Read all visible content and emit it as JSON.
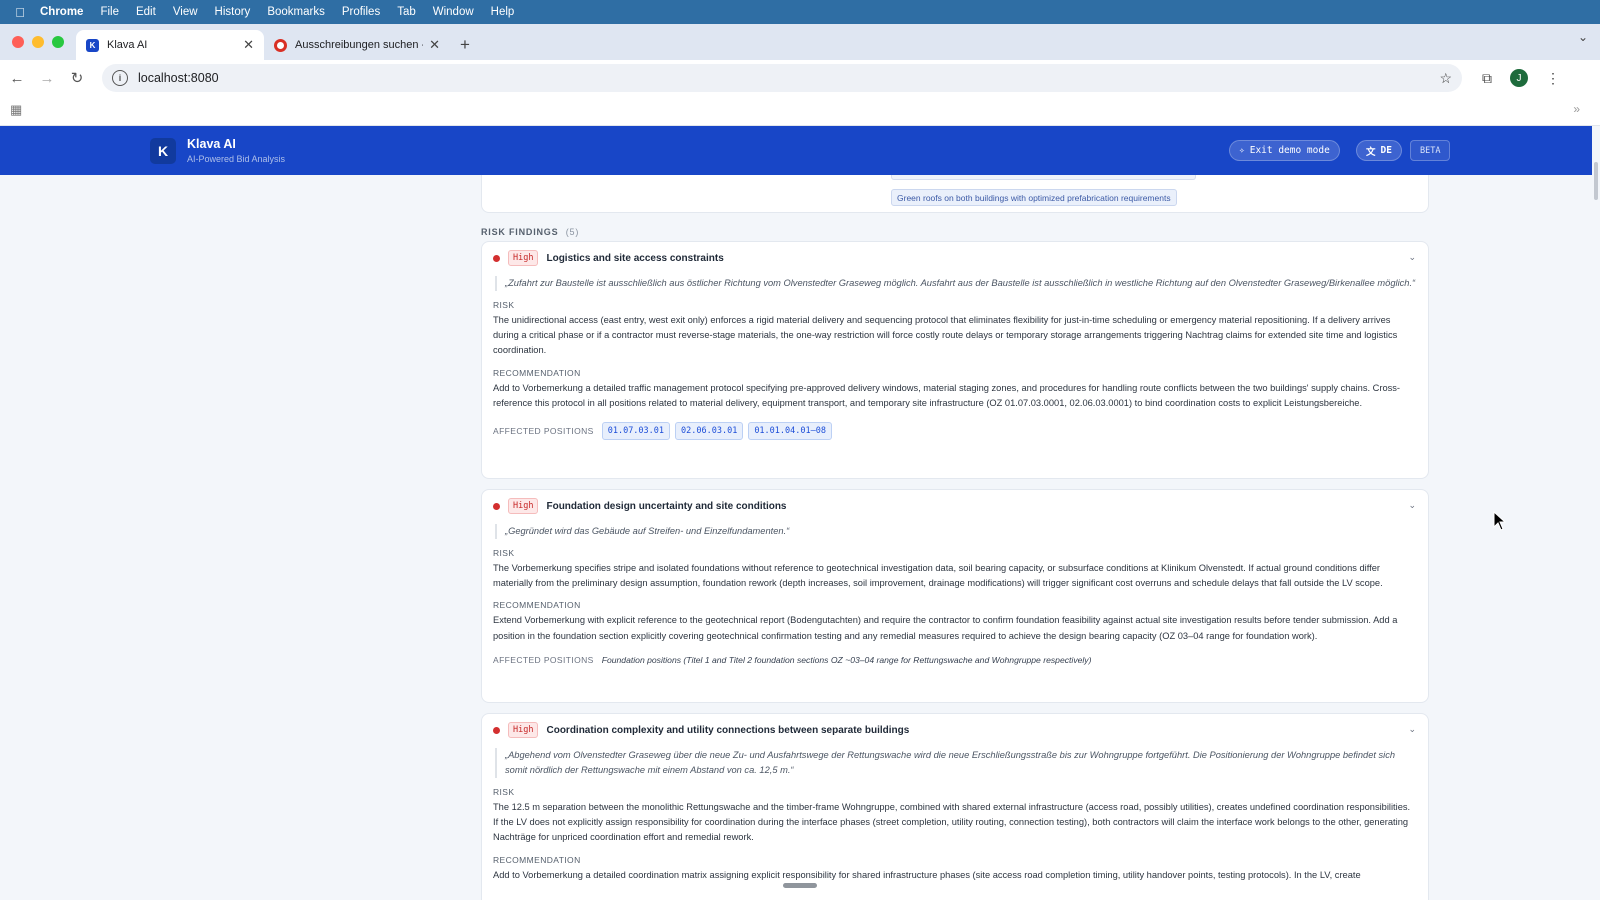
{
  "menubar": {
    "app": "Chrome",
    "items": [
      "File",
      "Edit",
      "View",
      "History",
      "Bookmarks",
      "Profiles",
      "Tab",
      "Window",
      "Help"
    ]
  },
  "tabs": [
    {
      "title": "Klava AI",
      "favicon": "K"
    },
    {
      "title": "Ausschreibungen suchen - e"
    }
  ],
  "address": {
    "url": "localhost:8080"
  },
  "app": {
    "logo": "K",
    "title": "Klava AI",
    "subtitle": "AI-Powered Bid Analysis",
    "exit_demo": "Exit demo mode",
    "lang": "DE",
    "beta": "BETA"
  },
  "top_card": {
    "strength_tag": "Green roofs on both buildings with optimized prefabrication requirements"
  },
  "risk_section": {
    "title": "RISK FINDINGS",
    "count": "(5)"
  },
  "labels": {
    "risk": "RISK",
    "recommendation": "RECOMMENDATION",
    "affected": "AFFECTED POSITIONS"
  },
  "findings": [
    {
      "severity": "High",
      "title": "Logistics and site access constraints",
      "quote": "„Zufahrt zur Baustelle ist ausschließlich aus östlicher Richtung vom Olvenstedter Graseweg möglich. Ausfahrt aus der Baustelle ist ausschließlich in westliche Richtung auf den Olvenstedter Graseweg/Birkenallee möglich.“",
      "risk": "The unidirectional access (east entry, west exit only) enforces a rigid material delivery and sequencing protocol that eliminates flexibility for just-in-time scheduling or emergency material repositioning. If a delivery arrives during a critical phase or if a contractor must reverse-stage materials, the one-way restriction will force costly route delays or temporary storage arrangements triggering Nachtrag claims for extended site time and logistics coordination.",
      "recommendation": "Add to Vorbemerkung a detailed traffic management protocol specifying pre-approved delivery windows, material staging zones, and procedures for handling route conflicts between the two buildings' supply chains. Cross-reference this protocol in all positions related to material delivery, equipment transport, and temporary site infrastructure (OZ 01.07.03.0001, 02.06.03.0001) to bind coordination costs to explicit Leistungsbereiche.",
      "positions": [
        "01.07.03.01",
        "02.06.03.01",
        "01.01.04.01–08"
      ]
    },
    {
      "severity": "High",
      "title": "Foundation design uncertainty and site conditions",
      "quote": "„Gegründet wird das Gebäude auf Streifen- und Einzelfundamenten.“",
      "risk": "The Vorbemerkung specifies stripe and isolated foundations without reference to geotechnical investigation data, soil bearing capacity, or subsurface conditions at Klinikum Olvenstedt. If actual ground conditions differ materially from the preliminary design assumption, foundation rework (depth increases, soil improvement, drainage modifications) will trigger significant cost overruns and schedule delays that fall outside the LV scope.",
      "recommendation": "Extend Vorbemerkung with explicit reference to the geotechnical report (Bodengutachten) and require the contractor to confirm foundation feasibility against actual site investigation results before tender submission. Add a position in the foundation section explicitly covering geotechnical confirmation testing and any remedial measures required to achieve the design bearing capacity (OZ 03–04 range for foundation work).",
      "positions_text": "Foundation positions (Titel 1 and Titel 2 foundation sections  OZ ~03–04 range for Rettungswache and Wohngruppe respectively)"
    },
    {
      "severity": "High",
      "title": "Coordination complexity and utility connections between separate buildings",
      "quote": "„Abgehend vom Olvenstedter Graseweg über die neue Zu- und Ausfahrtswege der Rettungswache wird die neue Erschließungsstraße bis zur Wohngruppe fortgeführt. Die Positionierung der Wohngruppe befindet sich somit nördlich der Rettungswache mit einem Abstand von ca. 12,5 m.“",
      "risk": "The 12.5 m separation between the monolithic Rettungswache and the timber-frame Wohngruppe, combined with shared external infrastructure (access road, possibly utilities), creates undefined coordination responsibilities. If the LV does not explicitly assign responsibility for coordination during the interface phases (street completion, utility routing, connection testing), both contractors will claim the interface work belongs to the other, generating Nachträge for unpriced coordination effort and remedial rework.",
      "recommendation": "Add to Vorbemerkung a detailed coordination matrix assigning explicit responsibility for shared infrastructure phases (site access road completion timing, utility handover points, testing protocols). In the LV, create"
    }
  ]
}
